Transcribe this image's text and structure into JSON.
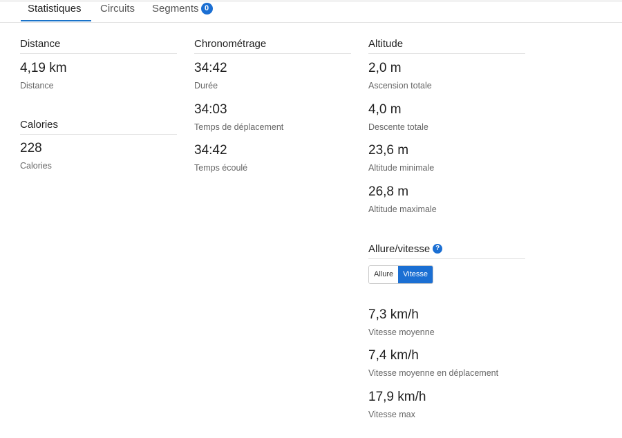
{
  "tabs": [
    {
      "label": "Statistiques"
    },
    {
      "label": "Circuits"
    },
    {
      "label": "Segments",
      "badge": "0"
    }
  ],
  "distance": {
    "title": "Distance",
    "stats": [
      {
        "value": "4,19 km",
        "label": "Distance"
      }
    ]
  },
  "calories": {
    "title": "Calories",
    "stats": [
      {
        "value": "228",
        "label": "Calories"
      }
    ]
  },
  "timing": {
    "title": "Chronométrage",
    "stats": [
      {
        "value": "34:42",
        "label": "Durée"
      },
      {
        "value": "34:03",
        "label": "Temps de déplacement"
      },
      {
        "value": "34:42",
        "label": "Temps écoulé"
      }
    ]
  },
  "altitude": {
    "title": "Altitude",
    "stats": [
      {
        "value": "2,0 m",
        "label": "Ascension totale"
      },
      {
        "value": "4,0 m",
        "label": "Descente totale"
      },
      {
        "value": "23,6 m",
        "label": "Altitude minimale"
      },
      {
        "value": "26,8 m",
        "label": "Altitude maximale"
      }
    ]
  },
  "pace_speed": {
    "title": "Allure/vitesse",
    "help_icon": "question-mark",
    "toggle": {
      "options": [
        "Allure",
        "Vitesse"
      ],
      "selected": "Vitesse"
    },
    "stats": [
      {
        "value": "7,3 km/h",
        "label": "Vitesse moyenne"
      },
      {
        "value": "7,4 km/h",
        "label": "Vitesse moyenne en déplacement"
      },
      {
        "value": "17,9 km/h",
        "label": "Vitesse max"
      }
    ]
  },
  "colors": {
    "accent": "#1b6fd3",
    "tab_underline": "#1a73c9"
  }
}
